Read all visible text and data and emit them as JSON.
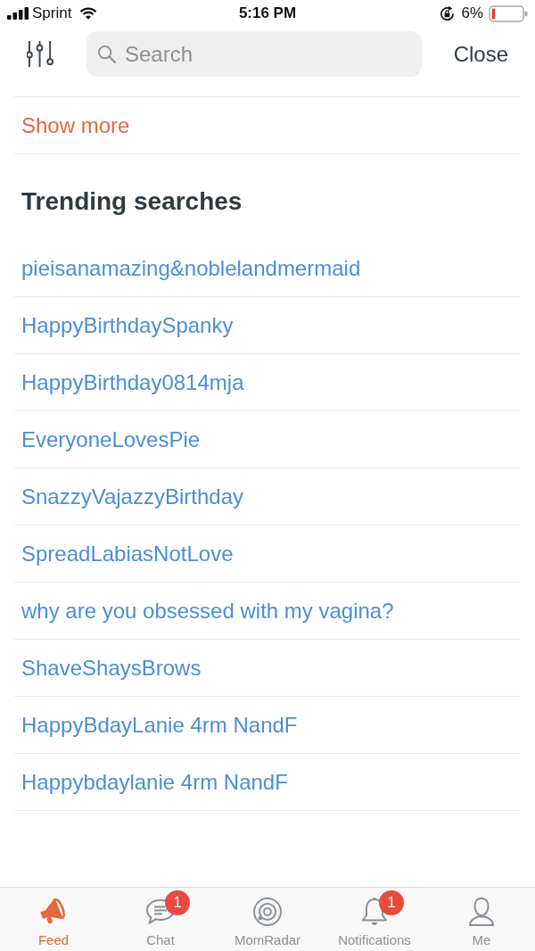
{
  "status_bar": {
    "carrier": "Sprint",
    "time": "5:16 PM",
    "battery_percent": "6%"
  },
  "search_bar": {
    "placeholder": "Search",
    "close_label": "Close"
  },
  "show_more": "Show more",
  "trending_searches": {
    "title": "Trending searches",
    "items": [
      "pieisanamazing&noblelandmermaid",
      "HappyBirthdaySpanky",
      "HappyBirthday0814mja",
      "EveryoneLovesPie",
      "SnazzyVajazzyBirthday",
      "SpreadLabiasNotLove",
      "why are you obsessed with my vagina?",
      "ShaveShaysBrows",
      "HappyBdayLanie 4rm NandF",
      "Happybdaylanie 4rm NandF"
    ]
  },
  "tab_bar": [
    {
      "kind": "feed",
      "label": "Feed",
      "selected": true
    },
    {
      "kind": "chat",
      "label": "Chat",
      "selected": false,
      "badge": "1"
    },
    {
      "kind": "radar",
      "label": "MomRadar",
      "selected": false
    },
    {
      "kind": "notifications",
      "label": "Notifications",
      "selected": false,
      "badge": "1"
    },
    {
      "kind": "me",
      "label": "Me",
      "selected": false
    }
  ]
}
